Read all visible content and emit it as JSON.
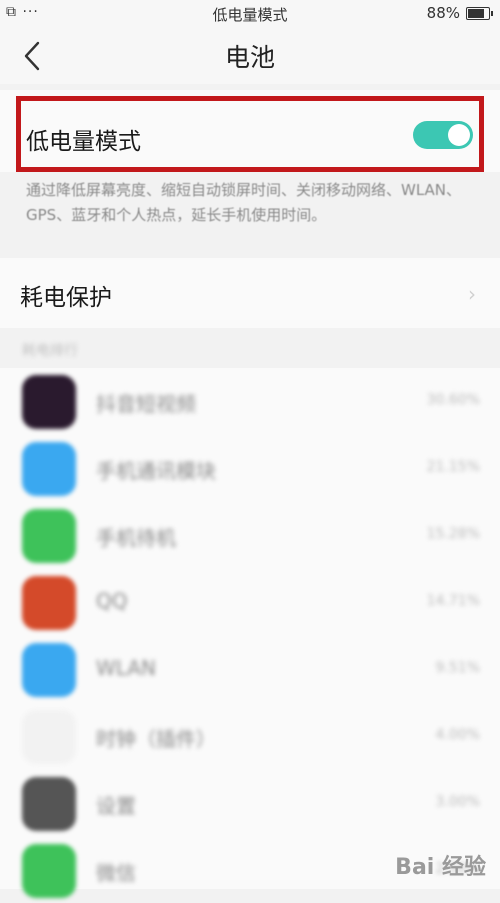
{
  "status_bar": {
    "left": "⧉ ···",
    "title": "低电量模式",
    "battery_text": "88%",
    "battery_level": 0.88
  },
  "nav": {
    "back_icon": "chevron-left-icon",
    "title": "电池"
  },
  "low_power": {
    "label": "低电量模式",
    "toggle_on": true,
    "toggle_color": "#3cc7b3",
    "highlight_color": "#c2181b",
    "description": "通过降低屏幕亮度、缩短自动锁屏时间、关闭移动网络、WLAN、GPS、蓝牙和个人热点，延长手机使用时间。"
  },
  "protect": {
    "label": "耗电保护"
  },
  "section_header": "耗电排行",
  "apps": [
    {
      "name": "抖音短视频",
      "percent": "30.60%",
      "icon_color": "#2a1a2e"
    },
    {
      "name": "手机通讯模块",
      "percent": "21.15%",
      "icon_color": "#3aa8f0"
    },
    {
      "name": "手机待机",
      "percent": "15.28%",
      "icon_color": "#3ec25a"
    },
    {
      "name": "QQ",
      "percent": "14.71%",
      "icon_color": "#d44a2a"
    },
    {
      "name": "WLAN",
      "percent": "9.51%",
      "icon_color": "#3aa8f0"
    },
    {
      "name": "时钟（插件）",
      "percent": "4.00%",
      "icon_color": "#f2f2f2"
    },
    {
      "name": "设置",
      "percent": "3.00%",
      "icon_color": "#555555"
    },
    {
      "name": "微信",
      "percent": "2.50%",
      "icon_color": "#3ec25a"
    }
  ],
  "watermark": "Bai 经验"
}
